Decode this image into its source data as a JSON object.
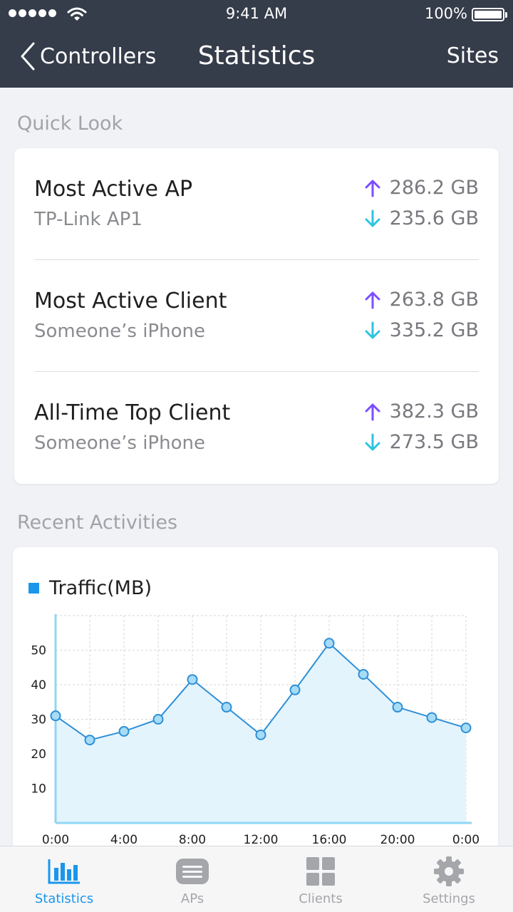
{
  "status_bar": {
    "time": "9:41 AM",
    "battery": "100%"
  },
  "nav": {
    "back_label": "Controllers",
    "title": "Statistics",
    "right_label": "Sites"
  },
  "quick_look": {
    "title": "Quick Look",
    "items": [
      {
        "label": "Most Active AP",
        "sublabel": "TP-Link AP1",
        "upload": "286.2 GB",
        "download": "235.6 GB"
      },
      {
        "label": "Most Active Client",
        "sublabel": "Someone’s iPhone",
        "upload": "263.8 GB",
        "download": "335.2 GB"
      },
      {
        "label": "All-Time Top Client",
        "sublabel": "Someone’s iPhone",
        "upload": "382.3 GB",
        "download": "273.5 GB"
      }
    ]
  },
  "recent": {
    "title": "Recent Activities"
  },
  "chart_data": {
    "type": "area",
    "series": [
      {
        "name": "Traffic(MB)",
        "values": [
          31,
          24,
          26.5,
          30,
          41.5,
          33.5,
          25.5,
          38.5,
          52,
          43,
          33.5,
          30.5,
          27.5
        ]
      }
    ],
    "x_ticks": [
      "0:00",
      "4:00",
      "8:00",
      "12:00",
      "16:00",
      "20:00",
      "0:00"
    ],
    "y_ticks": [
      10,
      20,
      30,
      40,
      50
    ],
    "ylim": [
      0,
      60
    ],
    "grid": true,
    "legend": "top-left"
  },
  "colors": {
    "nav_bg": "#353c4a",
    "accent": "#1a96eb",
    "upload_arrow": "#7c4dff",
    "download_arrow": "#2ec4de",
    "chart_line": "#2f8fd6",
    "chart_fill": "#e3f4fd",
    "chart_point": "#a6dcf6"
  },
  "tabs": [
    {
      "label": "Statistics",
      "icon": "bar-chart-icon",
      "active": true
    },
    {
      "label": "APs",
      "icon": "access-point-icon",
      "active": false
    },
    {
      "label": "Clients",
      "icon": "grid-icon",
      "active": false
    },
    {
      "label": "Settings",
      "icon": "gear-icon",
      "active": false
    }
  ]
}
